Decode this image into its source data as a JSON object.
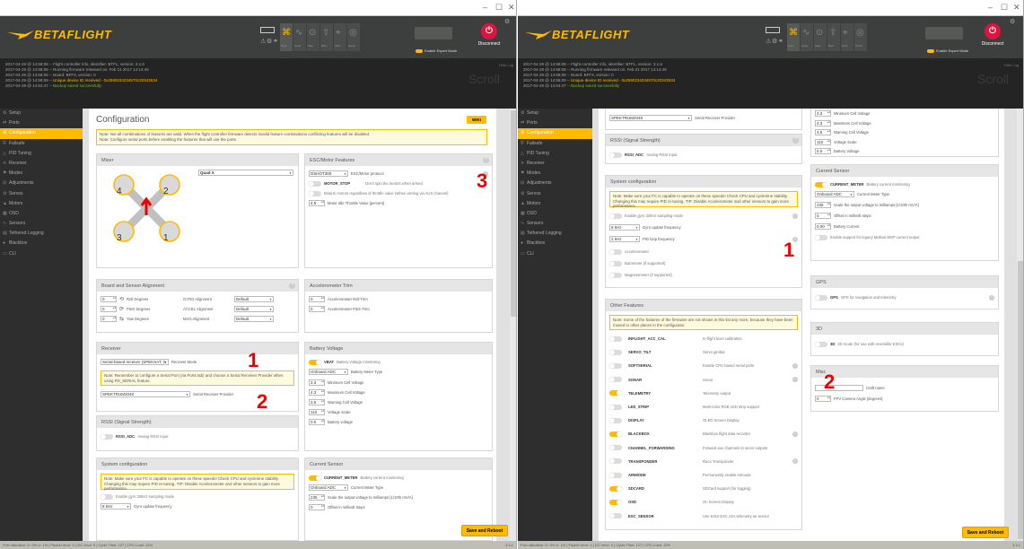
{
  "app": {
    "brand_main": "BETA",
    "brand_accent": "FLIGHT",
    "window_controls": [
      "–",
      "☐",
      "✕"
    ],
    "connect_note": "",
    "port_label": "",
    "expert_mode_label": "Enable Expert Mode",
    "disconnect_label": "Disconnect",
    "show_log_label": "Hide Log",
    "scroll_label": "Scroll",
    "sensor_labels": [
      "Gyro",
      "Accel",
      "Mag",
      "Baro",
      "GPS",
      "Sonar"
    ]
  },
  "log": [
    {
      "time": "2017-04-28 @ 14:58:08",
      "text": " -- Flight controller info, identifier: BTFL, version: 3.1.6"
    },
    {
      "time": "2017-04-28 @ 14:58:08",
      "text": " -- Running firmware released on: Feb 21 2017 14:14:49"
    },
    {
      "time": "2017-04-28 @ 14:58:08",
      "text": " -- Board: BFF3, version: 0"
    },
    {
      "time": "2017-04-28 @ 14:58:09",
      "text": " -- Unique device ID received - 0x2590234234570c20343534"
    },
    {
      "time": "2017-04-28 @ 14:54:47",
      "text": " -- Backup saved successfully"
    }
  ],
  "nav": [
    {
      "label": "Setup",
      "icon": "⚙"
    },
    {
      "label": "Ports",
      "icon": "⇄"
    },
    {
      "label": "Configuration",
      "icon": "⚙"
    },
    {
      "label": "Failsafe",
      "icon": "⛨"
    },
    {
      "label": "PID Tuning",
      "icon": "△"
    },
    {
      "label": "Receiver",
      "icon": "✈"
    },
    {
      "label": "Modes",
      "icon": "⚑"
    },
    {
      "label": "Adjustments",
      "icon": "⊟"
    },
    {
      "label": "Servos",
      "icon": "⚙"
    },
    {
      "label": "Motors",
      "icon": "▲"
    },
    {
      "label": "OSD",
      "icon": "▦"
    },
    {
      "label": "Sensors",
      "icon": "∿"
    },
    {
      "label": "Tethered Logging",
      "icon": "▤"
    },
    {
      "label": "Blackbox",
      "icon": "●"
    },
    {
      "label": "CLI",
      "icon": "▭"
    }
  ],
  "left": {
    "title": "Configuration",
    "wiki": "WIKI",
    "note_top_1": "Note: Not all combinations of features are valid. When the flight controller firmware detects invalid feature combinations conflicting features will be disabled.",
    "note_top_2": "Note: Configure serial ports before enabling the features that will use the ports.",
    "mixer": {
      "title": "Mixer",
      "value": "Quad X",
      "motors": [
        "4",
        "2",
        "3",
        "1"
      ]
    },
    "esc": {
      "title": "ESC/Motor Features",
      "protocol": "DSHOT300",
      "protocol_label": "ESC/Motor protocol",
      "motor_stop": "MOTOR_STOP",
      "motor_stop_desc": "Don't spin the motors when armed",
      "disarm_desc": "Disarm motors regardless of throttle value (When arming via AUX channel)",
      "idle_value": "4.5",
      "idle_label": "Motor Idle Throttle Value [percent]"
    },
    "alignment": {
      "title": "Board and Sensor Alignment",
      "rows": [
        {
          "v": "0",
          "l": "Roll Degrees",
          "s": "GYRO Alignment",
          "d": "Default"
        },
        {
          "v": "0",
          "l": "Pitch Degrees",
          "s": "ACCEL Alignment",
          "d": "Default"
        },
        {
          "v": "0",
          "l": "Yaw Degrees",
          "s": "MAG Alignment",
          "d": "Default"
        }
      ]
    },
    "acc_trim": {
      "title": "Accelerometer Trim",
      "rows": [
        {
          "v": "0",
          "l": "Accelerometer Roll Trim"
        },
        {
          "v": "0",
          "l": "Accelerometer Pitch Trim"
        }
      ]
    },
    "receiver": {
      "title": "Receiver",
      "mode": "Serial-based receiver (SPEKSAT, S",
      "mode_label": "Receiver Mode",
      "note": "Note: Remember to configure a Serial Port (via Ports tab) and choose a Serial Receiver Provider when using RX_SERIAL feature.",
      "provider": "SPEKTRUM2048",
      "provider_label": "Serial Receiver Provider"
    },
    "battery": {
      "title": "Battery Voltage",
      "vbat": "VBAT",
      "vbat_desc": "Battery voltage monitoring",
      "meter": "Onboard ADC",
      "meter_label": "Battery Meter Type",
      "rows": [
        {
          "v": "3.3",
          "l": "Minimum Cell Voltage"
        },
        {
          "v": "4.3",
          "l": "Maximum Cell Voltage"
        },
        {
          "v": "3.5",
          "l": "Warning Cell Voltage"
        },
        {
          "v": "110",
          "l": "Voltage Scale"
        },
        {
          "v": "0.0",
          "l": "Battery voltage"
        }
      ]
    },
    "rssi": {
      "title": "RSSI (Signal Strength)",
      "name": "RSSI_ADC",
      "desc": "Analog RSSI input"
    },
    "system": {
      "title": "System configuration",
      "note": "Note: Make sure your FC is capable to operate on these speeds! Check CPU and cyclerime stability. Changing this may require PID re-tuning. TIP: Disable Accelerometer and other sensors to gain more performance.",
      "gyro32": "Enable gyro 32kHz sampling mode",
      "freq": "8 kHz",
      "freq_label": "Gyro update frequency"
    },
    "current": {
      "title": "Current Sensor",
      "name": "CURRENT_METER",
      "desc": "Battery current monitoring",
      "meter": "Onboard ADC",
      "meter_label": "Current Meter Type",
      "scale": "235",
      "scale_label": "Scale the output voltage to milliamps [1/10th mV/A]",
      "offset": "0",
      "offset_label": "Offset in millivolt steps"
    },
    "save": "Save and Reboot",
    "markers": [
      "3",
      "1",
      "2"
    ]
  },
  "right": {
    "receiver_provider": "SPEKTRUM2048",
    "receiver_provider_label": "Serial Receiver Provider",
    "rssi": {
      "title": "RSSI (Signal Strength)",
      "name": "RSSI_ADC",
      "desc": "Analog RSSI input"
    },
    "system": {
      "title": "System configuration",
      "note": "Note: Make sure your FC is capable to operate on these speeds! Check CPU and cyclerime stability. Changing this may require PID re-tuning. TIP: Disable Accelerometer and other sensors to gain more performance.",
      "gyro32": "Enable gyro 32kHz sampling mode",
      "gyro_freq": "8 kHz",
      "gyro_freq_label": "Gyro update frequency",
      "pid_freq": "2 kHz",
      "pid_freq_label": "PID loop frequency",
      "acc": "Accelerometer",
      "baro": "Barometer (if supported)",
      "mag": "Magnetometer (if supported)"
    },
    "other": {
      "title": "Other Features",
      "note": "Note: Some of the features of the firmware are not shown in this list any more, because they have been moved to other places in the configurator.",
      "features": [
        {
          "n": "INFLIGHT_ACC_CAL",
          "d": "In-flight level calibration",
          "on": false,
          "q": false
        },
        {
          "n": "SERVO_TILT",
          "d": "Servo gimbal",
          "on": false,
          "q": false
        },
        {
          "n": "SOFTSERIAL",
          "d": "Enable CPU based serial ports",
          "on": false,
          "q": true
        },
        {
          "n": "SONAR",
          "d": "Sonar",
          "on": false,
          "q": true
        },
        {
          "n": "TELEMETRY",
          "d": "Telemetry output",
          "on": true,
          "q": false
        },
        {
          "n": "LED_STRIP",
          "d": "Multi-color RGB LED strip support",
          "on": false,
          "q": false
        },
        {
          "n": "DISPLAY",
          "d": "OLED Screen Display",
          "on": false,
          "q": false
        },
        {
          "n": "BLACKBOX",
          "d": "Blackbox flight data recorder",
          "on": true,
          "q": true
        },
        {
          "n": "CHANNEL_FORWARDING",
          "d": "Forward aux channels to servo outputs",
          "on": false,
          "q": false
        },
        {
          "n": "TRANSPONDER",
          "d": "Race Transponder",
          "on": false,
          "q": true
        },
        {
          "n": "AIRMODE",
          "d": "Permanently enable Airmode",
          "on": false,
          "q": false
        },
        {
          "n": "SDCARD",
          "d": "SDCard support (for logging)",
          "on": true,
          "q": false
        },
        {
          "n": "OSD",
          "d": "On Screen Display",
          "on": true,
          "q": false
        },
        {
          "n": "ESC_SENSOR",
          "d": "Use KISS ESC 24A telemetry as sensor",
          "on": false,
          "q": false
        }
      ]
    },
    "battery": {
      "rows": [
        {
          "v": "3.3",
          "l": "Minimum Cell Voltage"
        },
        {
          "v": "4.3",
          "l": "Maximum Cell Voltage"
        },
        {
          "v": "3.5",
          "l": "Warning Cell Voltage"
        },
        {
          "v": "110",
          "l": "Voltage Scale"
        },
        {
          "v": "0.0",
          "l": "Battery Voltage"
        }
      ]
    },
    "current": {
      "title": "Current Sensor",
      "name": "CURRENT_METER",
      "desc": "Battery current monitoring",
      "meter": "Onboard ADC",
      "meter_label": "Current Meter Type",
      "scale": "235",
      "scale_label": "Scale the output voltage to milliamps [1/10th mV/A]",
      "offset": "0",
      "offset_label": "Offset in millivolt steps",
      "current": "0.00",
      "current_label": "Battery Current",
      "legacy": "Enable support for legacy Multiwii MSP current output"
    },
    "gps": {
      "title": "GPS",
      "name": "GPS",
      "desc": "GPS for navigation and telemetry"
    },
    "threed": {
      "title": "3D",
      "name": "3D",
      "desc": "3D mode (for use with reversible ESCs)"
    },
    "misc": {
      "title": "Misc",
      "craft_label": "Craft name",
      "fpv": "0",
      "fpv_label": "FPV Camera Angle [degrees]"
    },
    "save": "Save and Reboot",
    "markers": [
      "1",
      "2"
    ]
  },
  "status": {
    "text": "Port utilization: D: 0% U: 1%  |  Packet error: 0  |  I2C error: 0  |  Cycle Time: 127  |  CPU Load: 14%",
    "version": "3.3.1"
  },
  "colors": {
    "accent": "#ffbb00",
    "header": "#3d3f3e",
    "log": "#242424",
    "nav": "#2e2e2e",
    "marker": "#e00000"
  }
}
